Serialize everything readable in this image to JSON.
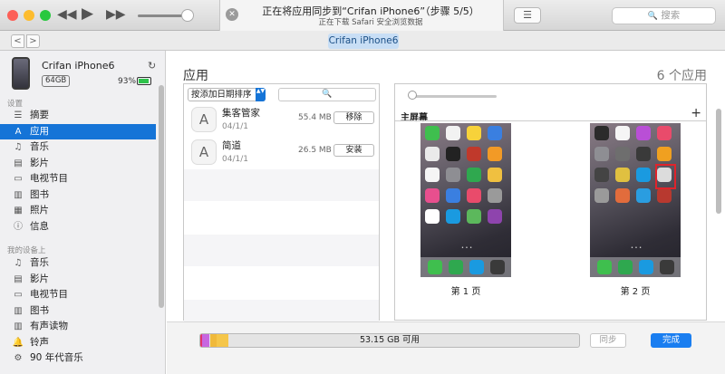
{
  "toolbar": {
    "status_title": "正在将应用同步到“Crifan iPhone6”（步骤 5/5）",
    "status_subtitle": "正在下载 Safari 安全浏览数据",
    "search_placeholder": "搜索",
    "cancel_glyph": "✕",
    "rewind_glyph": "◀◀",
    "play_glyph": "▶",
    "forward_glyph": "▶▶",
    "list_glyph": "☰",
    "search_glyph": "🔍"
  },
  "nav": {
    "back_glyph": "<",
    "forward_glyph": ">",
    "device_pill": "Crifan iPhone6"
  },
  "sidebar": {
    "device_name": "Crifan iPhone6",
    "capacity": "64GB",
    "battery": "93%",
    "sync_glyph": "↻",
    "battery_fill": 0.93,
    "settings_header": "设置",
    "settings_items": [
      {
        "label": "摘要",
        "icon": "summary-icon",
        "glyph": "☰"
      },
      {
        "label": "应用",
        "icon": "apps-icon",
        "glyph": "A",
        "selected": true
      },
      {
        "label": "音乐",
        "icon": "music-icon",
        "glyph": "♫"
      },
      {
        "label": "影片",
        "icon": "movies-icon",
        "glyph": "▤"
      },
      {
        "label": "电视节目",
        "icon": "tv-icon",
        "glyph": "▭"
      },
      {
        "label": "图书",
        "icon": "book-icon",
        "glyph": "▥"
      },
      {
        "label": "照片",
        "icon": "photos-icon",
        "glyph": "▦"
      },
      {
        "label": "信息",
        "icon": "info-icon",
        "glyph": "ⓘ"
      }
    ],
    "mydevice_header": "我的设备上",
    "device_items": [
      {
        "label": "音乐",
        "icon": "music-icon",
        "glyph": "♫"
      },
      {
        "label": "影片",
        "icon": "movies-icon",
        "glyph": "▤"
      },
      {
        "label": "电视节目",
        "icon": "tv-icon",
        "glyph": "▭"
      },
      {
        "label": "图书",
        "icon": "book-icon",
        "glyph": "▥"
      },
      {
        "label": "有声读物",
        "icon": "audiobook-icon",
        "glyph": "▥"
      },
      {
        "label": "铃声",
        "icon": "bell-icon",
        "glyph": "🔔"
      },
      {
        "label": "90 年代音乐",
        "icon": "playlist-icon",
        "glyph": "⚙"
      }
    ]
  },
  "apps": {
    "title": "应用",
    "count": "6 个应用",
    "sort_label": "按添加日期排序",
    "sort_arrow": "▲▼",
    "app_icon_glyph": "A",
    "search_glyph": "🔍",
    "list": [
      {
        "name": "集客管家",
        "date": "04/1/1",
        "size": "55.4 MB",
        "action": "移除"
      },
      {
        "name": "简道",
        "date": "04/1/1",
        "size": "26.5 MB",
        "action": "安装"
      }
    ]
  },
  "screens": {
    "home_label": "主屏幕",
    "add_label": "+",
    "dots": "• • •",
    "pages": [
      "第 1 页",
      "第 2 页"
    ]
  },
  "footer": {
    "free_text": "53.15 GB 可用",
    "sync_button": "同步",
    "done_button": "完成",
    "usage_fractions": [
      0.005,
      0.02,
      0.018,
      0.03
    ]
  },
  "colors": {
    "accent": "#1574d7",
    "done": "#1a7ef0",
    "highlight": "#e0232b",
    "usage_segments": [
      "#e0336c",
      "#c766e0",
      "#f0b93a",
      "#f5c64a"
    ]
  }
}
